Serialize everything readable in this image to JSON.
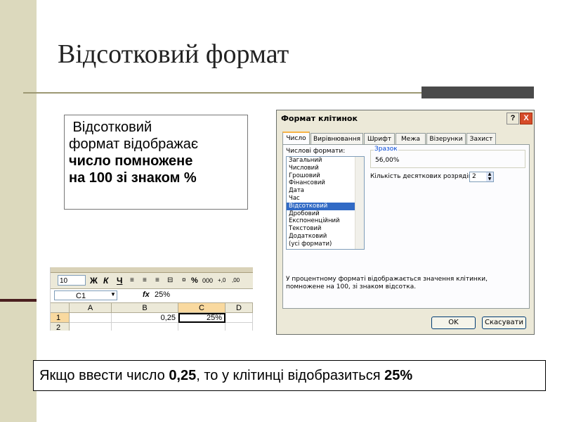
{
  "slide": {
    "title": "Відсотковий формат",
    "definition": {
      "line1": " Відсотковий",
      "line2": "формат відображає",
      "line3": "число помножене",
      "line4": "на 100 зі знаком %"
    },
    "bottom": {
      "part1": "Якщо ввести число ",
      "value": "0,25",
      "part2": ", то у клітинці відобразиться ",
      "result": "25%"
    }
  },
  "excel": {
    "font_size": "10",
    "toolbar": {
      "bold": "Ж",
      "italic": "К",
      "underline": "Ч",
      "percent": "%",
      "thousands": "000",
      "inc_decimal": "+,0",
      "dec_decimal": ",00"
    },
    "name_box": "C1",
    "fx": "fx",
    "formula_value": "25%",
    "columns": [
      "A",
      "B",
      "C",
      "D"
    ],
    "rows": [
      "1",
      "2"
    ],
    "cells": {
      "B1": "0,25",
      "C1": "25%"
    }
  },
  "dialog": {
    "title": "Формат клітинок",
    "help": "?",
    "close": "X",
    "tabs": [
      "Число",
      "Вирівнювання",
      "Шрифт",
      "Межа",
      "Візерунки",
      "Захист"
    ],
    "formats_label": "Числові формати:",
    "formats": [
      "Загальний",
      "Числовий",
      "Грошовий",
      "Фінансовий",
      "Дата",
      "Час",
      "Відсотковий",
      "Дробовий",
      "Експоненційний",
      "Текстовий",
      "Додатковий",
      "(усі формати)"
    ],
    "selected_format": "Відсотковий",
    "sample_label": "Зразок",
    "sample_value": "56,00%",
    "decimals_label": "Кількість десяткових розрядів:",
    "decimals_value": "2",
    "description": "У процентному форматі відображається значення клітинки, помножене на 100, зі знаком відсотка.",
    "ok": "OK",
    "cancel": "Скасувати"
  },
  "colors": {
    "strip": "#dcd9bd",
    "selection": "#316ac5",
    "close_button": "#d64b28"
  }
}
